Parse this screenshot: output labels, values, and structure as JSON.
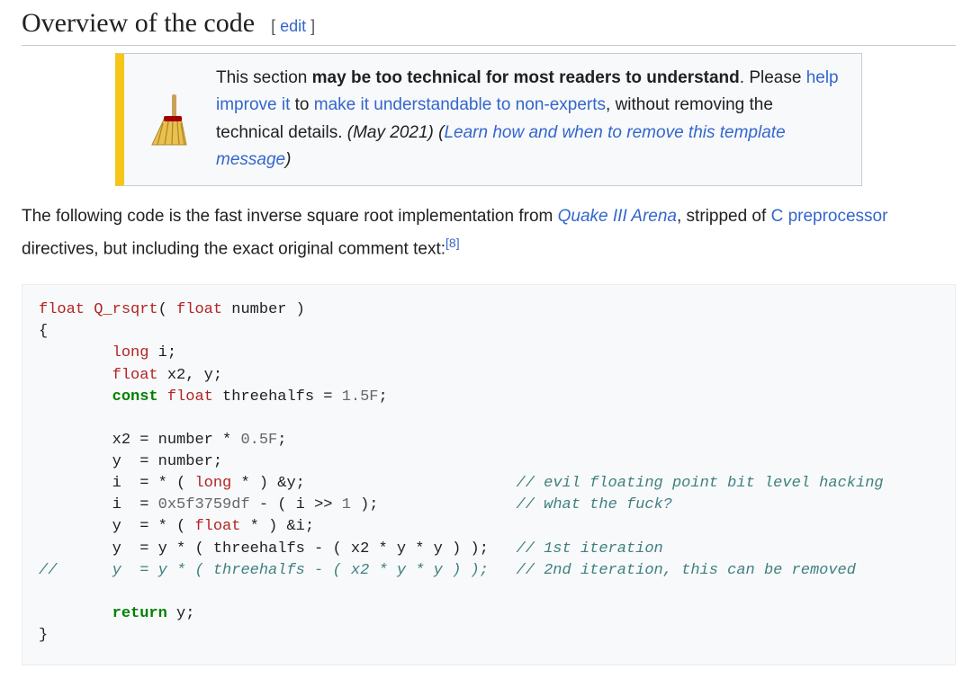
{
  "heading": {
    "title": "Overview of the code",
    "edit_prefix": "[ ",
    "edit_link": "edit",
    "edit_suffix": " ]"
  },
  "ambox": {
    "t1": "This section ",
    "bold": "may be too technical for most readers to understand",
    "t2": ". Please ",
    "link_help": "help improve it",
    "t3": " to ",
    "link_understand": "make it understandable to non-experts",
    "t4": ", without removing the technical details. ",
    "date": "(May 2021)",
    "paren_open": " (",
    "link_learn": "Learn how and when to remove this template message",
    "paren_close": ")"
  },
  "para": {
    "t1": "The following code is the fast inverse square root implementation from ",
    "link_quake": "Quake III Arena",
    "t2": ", stripped of ",
    "link_cpre": "C preprocessor",
    "t3": " directives, but including the exact original comment text:",
    "ref": "[8]"
  },
  "code": {
    "kw_float": "float",
    "fn_name": "Q_rsqrt",
    "sig_open": "( ",
    "param_type": "float",
    "sig_rest": " number )",
    "brace_open": "{",
    "decl_long": "long",
    "decl_long_rest": " i;",
    "decl_float": "float",
    "decl_float_rest": " x2, y;",
    "kw_const": "const",
    "decl_const_float": "float",
    "decl_threehalfs": " threehalfs = ",
    "num_1_5": "1.5F",
    "semi": ";",
    "ln_x2": "\tx2 = number * ",
    "num_0_5": "0.5F",
    "ln_y_num": "\ty  = number;",
    "ln_i_cast_a": "\ti  = * ( ",
    "cast_long": "long",
    "ln_i_cast_b": " * ) &y;                       ",
    "com_evil": "// evil floating point bit level hacking",
    "ln_magic_a": "\ti  = ",
    "num_magic": "0x5f3759df",
    "ln_magic_b": " - ( i >> ",
    "num_1": "1",
    "ln_magic_c": " );               ",
    "com_wtf": "// what the fuck?",
    "ln_y_cast_a": "\ty  = * ( ",
    "cast_float": "float",
    "ln_y_cast_b": " * ) &i;",
    "ln_iter1": "\ty  = y * ( threehalfs - ( x2 * y * y ) );   ",
    "com_iter1": "// 1st iteration",
    "com_iter2_line": "//\ty  = y * ( threehalfs - ( x2 * y * y ) );   // 2nd iteration, this can be removed",
    "kw_return": "return",
    "ret_rest": " y;",
    "brace_close": "}"
  }
}
